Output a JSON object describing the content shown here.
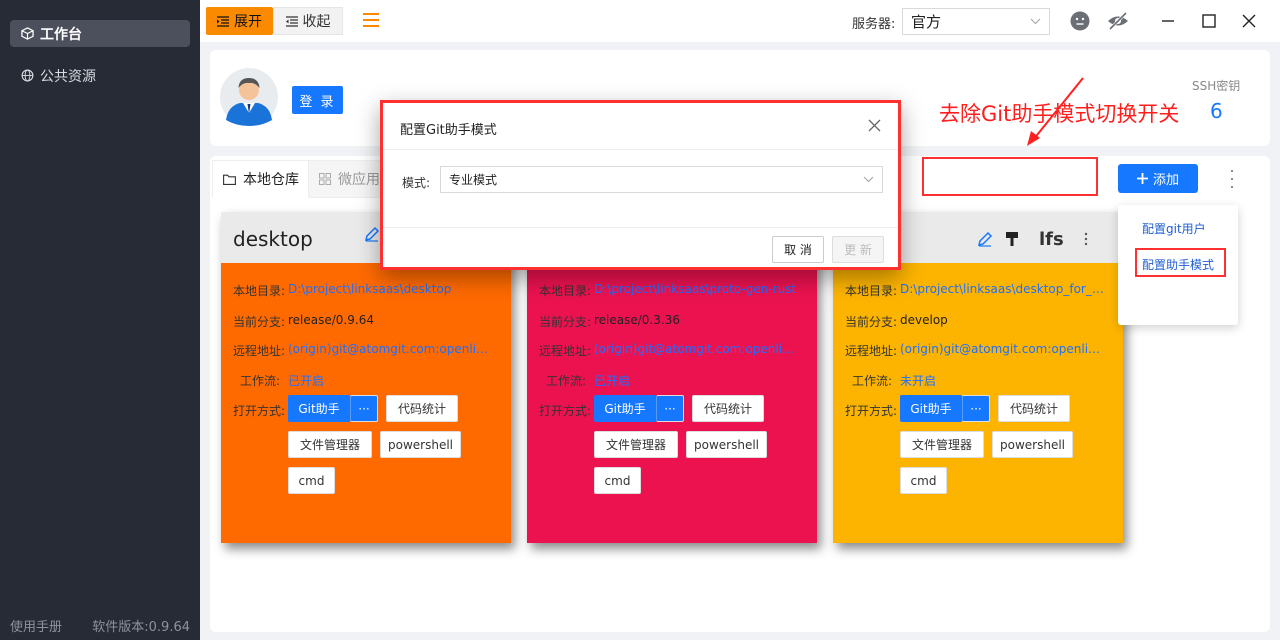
{
  "sidebar": {
    "items": [
      {
        "label": "工作台",
        "icon": "cube-icon",
        "active": true
      },
      {
        "label": "公共资源",
        "icon": "globe-icon",
        "active": false
      }
    ],
    "footer": {
      "manual": "使用手册",
      "version": "软件版本:0.9.64"
    }
  },
  "topbar": {
    "expand_label": "展开",
    "collapse_label": "收起",
    "server_label": "服务器:",
    "server_value": "官方",
    "accent": "#fb8a00"
  },
  "user_panel": {
    "login_label": "登 录",
    "ssh_label": "SSH密钥",
    "ssh_count": "6"
  },
  "annotation": "去除Git助手模式切换开关",
  "tabs": [
    {
      "label": "本地仓库",
      "icon": "folder-icon",
      "active": true
    },
    {
      "label": "微应用",
      "icon": "grid-icon",
      "active": false
    }
  ],
  "actions": {
    "add_label": "添加"
  },
  "menu": {
    "items": [
      "配置git用户",
      "配置助手模式"
    ]
  },
  "dialog": {
    "title": "配置Git助手模式",
    "mode_label": "模式:",
    "mode_value": "专业模式",
    "cancel_label": "取 消",
    "update_label": "更 新"
  },
  "card_labels": {
    "dir": "本地目录:",
    "branch": "当前分支:",
    "remote": "远程地址:",
    "workflow": "工作流:",
    "open": "打开方式:",
    "git": "Git助手",
    "more": "···",
    "code_stats": "代码统计",
    "file_manager": "文件管理器",
    "powershell": "powershell",
    "cmd": "cmd",
    "lfs": "lfs"
  },
  "cards": [
    {
      "name": "desktop",
      "color": "#ff6a00",
      "dir": "D:\\project\\linksaas\\desktop",
      "branch": "release/0.9.64",
      "remote": "(origin)git@atomgit.com:openlinksaas/desktop.git",
      "workflow": "已开启"
    },
    {
      "name": "",
      "color": "#ec1250",
      "dir": "D:\\project\\linksaas\\proto-gen-rust",
      "branch": "release/0.3.36",
      "remote": "(origin)git@atomgit.com:openlinksaas/proto.git",
      "workflow": "已开启"
    },
    {
      "name": "",
      "color": "#fdb400",
      "dir": "D:\\project\\linksaas\\desktop_for_atomgit",
      "branch": "develop",
      "remote": "(origin)git@atomgit.com:openlinksaas/desktop.git",
      "workflow": "未开启"
    }
  ]
}
